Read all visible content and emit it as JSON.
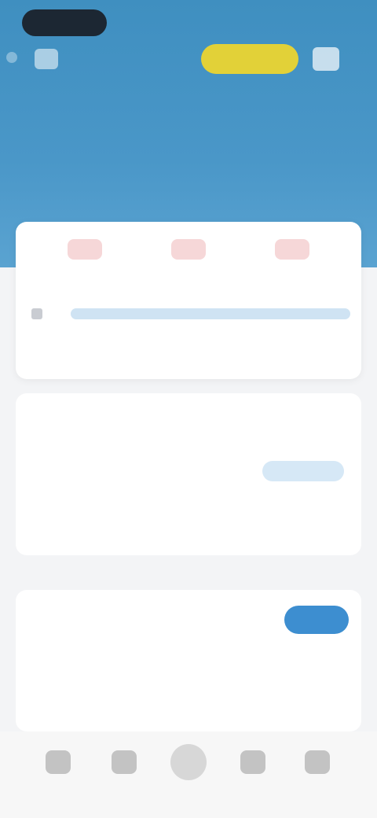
{
  "header": {
    "status_time": "",
    "status_right": "",
    "vip_badge": "",
    "subtitle": "",
    "caption": ""
  },
  "quick_actions": [
    {
      "label": "",
      "icon": "red-app-icon"
    },
    {
      "label": "",
      "icon": "red-app-icon"
    },
    {
      "label": "",
      "icon": "red-app-icon"
    }
  ],
  "notice": {
    "text": "",
    "sub": ""
  },
  "card1": {
    "title": "",
    "more": "",
    "sub": "",
    "button": "",
    "stats": [
      {
        "value": "",
        "label": ""
      },
      {
        "value": "",
        "label": ""
      },
      {
        "value": "",
        "label": ""
      },
      {
        "value": "",
        "label": ""
      }
    ]
  },
  "card2": {
    "title": "",
    "button": "",
    "link": "",
    "tag_left": "",
    "tag_right": "",
    "note": ""
  },
  "tabbar": {
    "items": [
      {
        "label": "",
        "icon": "home-icon"
      },
      {
        "label": "",
        "icon": "grid-icon"
      },
      {
        "label": "",
        "icon": "center-action-icon"
      },
      {
        "label": "",
        "icon": "message-icon"
      },
      {
        "label": "",
        "icon": "profile-icon"
      }
    ]
  },
  "colors": {
    "hero_blue": "#4a97c8",
    "vip_yellow": "#e2d138",
    "primary_blue": "#3d8ed0",
    "quick_icon_pink": "#f6d7d8"
  }
}
